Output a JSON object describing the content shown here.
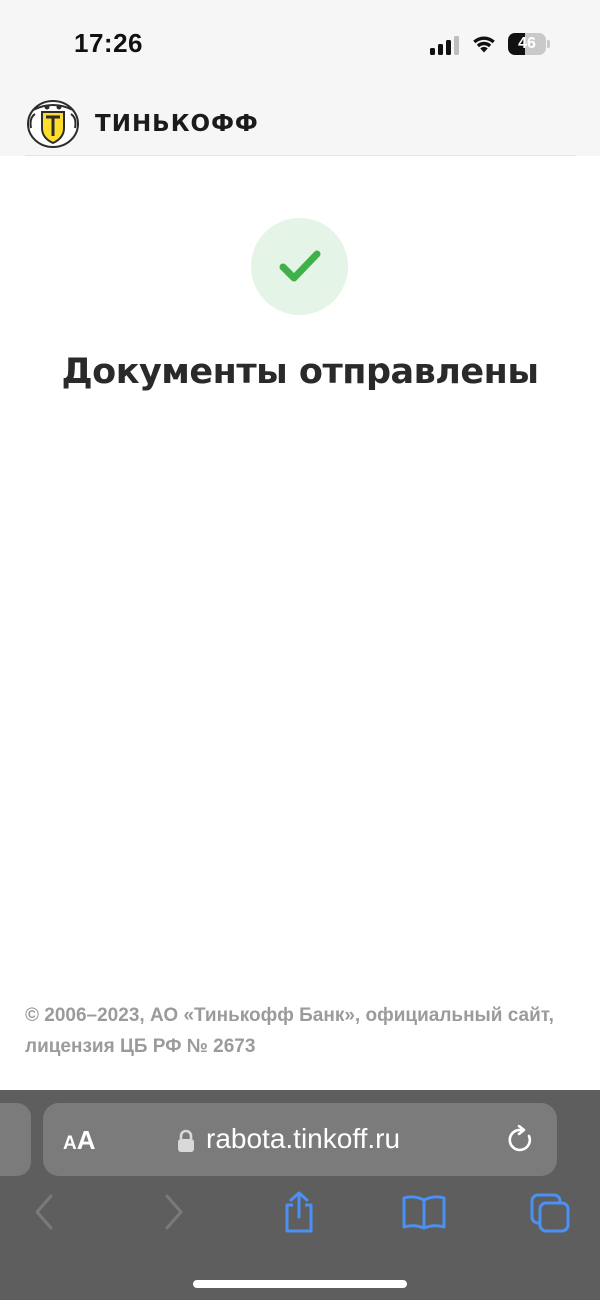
{
  "status_bar": {
    "time": "17:26",
    "battery_level": "46",
    "signal_bars": 3,
    "wifi": true
  },
  "header": {
    "brand_name": "ТИНЬКОФФ",
    "logo": "tinkoff-coat-of-arms-logo"
  },
  "main": {
    "status_icon": "checkmark-icon",
    "title": "Документы отправлены"
  },
  "footer": {
    "copyright": "© 2006–2023, АО «Тинькофф Банк», официальный сайт, лицензия ЦБ РФ № 2673"
  },
  "browser": {
    "text_size_label_small": "A",
    "text_size_label_large": "A",
    "url": "rabota.tinkoff.ru",
    "icons": [
      "lock-icon",
      "reload-icon",
      "back-icon",
      "forward-icon",
      "share-icon",
      "bookmarks-icon",
      "tabs-icon"
    ]
  },
  "colors": {
    "success_badge_bg": "#e4f4e6",
    "success_check": "#3fb04a",
    "brand_yellow": "#ffdd2d",
    "safari_accent": "#4a90f5",
    "footer_text": "#9b9b9b"
  }
}
